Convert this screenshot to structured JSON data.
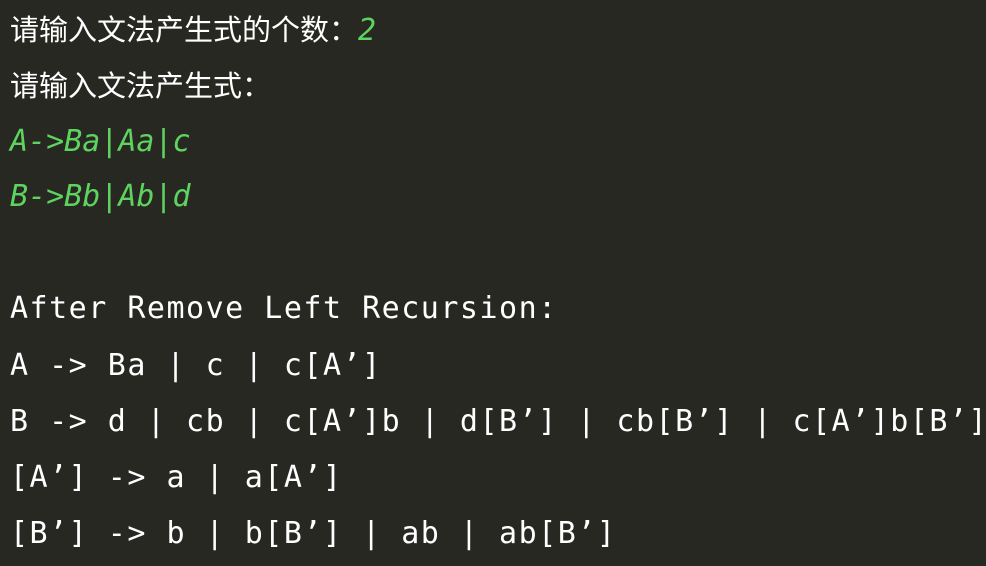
{
  "terminal": {
    "background": "#272822",
    "text_color": "#ffffff",
    "input_color": "#5fd35f",
    "prompt_count": "请输入文法产生式的个数：",
    "count_value": "2",
    "prompt_productions": "请输入文法产生式：",
    "productions": [
      "A->Ba|Aa|c",
      "B->Bb|Ab|d"
    ],
    "result_header": "After Remove Left Recursion:",
    "results": [
      "A -> Ba | c | c[A’]",
      "B -> d | cb | c[A’]b | d[B’] | cb[B’] | c[A’]b[B’]",
      "[A’] -> a | a[A’]",
      "[B’] -> b | b[B’] | ab | ab[B’]"
    ]
  }
}
